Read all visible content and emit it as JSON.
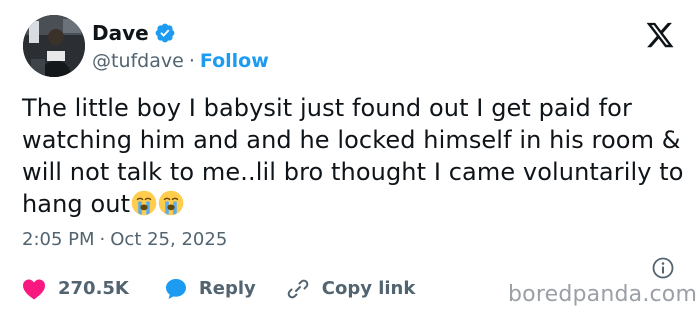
{
  "author": {
    "name": "Dave",
    "handle": "@tufdave",
    "separator": "·",
    "follow_label": "Follow",
    "verified": true
  },
  "tweet": {
    "text": "The little boy I babysit just found out I get paid for watching him and and he locked himself in his room & will not talk to me..lil bro thought I came voluntarily to hang out",
    "emojis": [
      "loudly-crying-face",
      "loudly-crying-face"
    ],
    "time": "2:05 PM",
    "separator": "·",
    "date": "Oct 25, 2025"
  },
  "actions": {
    "likes": "270.5K",
    "reply_label": "Reply",
    "copy_label": "Copy link"
  },
  "watermark": "boredpanda.com",
  "colors": {
    "accent": "#1d9bf0",
    "like": "#f91880",
    "text": "#0f1419",
    "secondary": "#536471"
  }
}
